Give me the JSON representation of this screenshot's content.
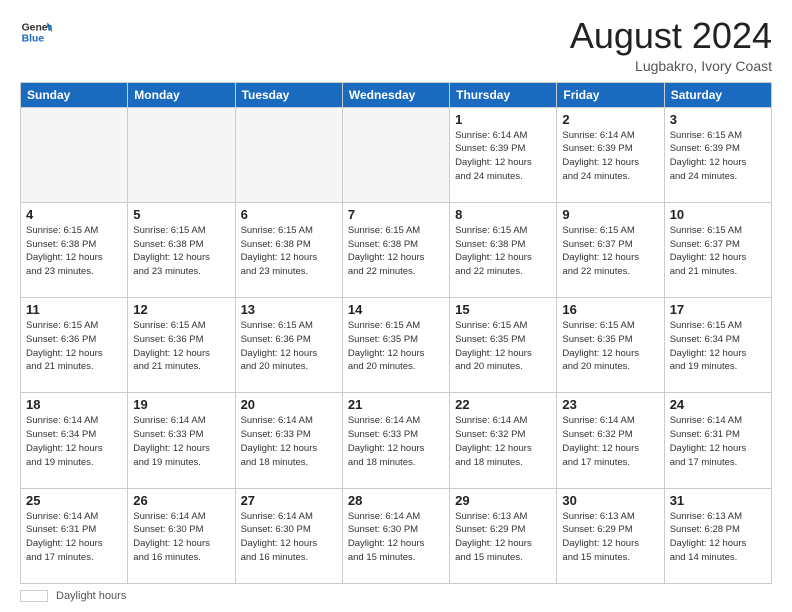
{
  "header": {
    "logo_general": "General",
    "logo_blue": "Blue",
    "title": "August 2024",
    "subtitle": "Lugbakro, Ivory Coast"
  },
  "days_of_week": [
    "Sunday",
    "Monday",
    "Tuesday",
    "Wednesday",
    "Thursday",
    "Friday",
    "Saturday"
  ],
  "weeks": [
    [
      {
        "day": "",
        "detail": ""
      },
      {
        "day": "",
        "detail": ""
      },
      {
        "day": "",
        "detail": ""
      },
      {
        "day": "",
        "detail": ""
      },
      {
        "day": "1",
        "detail": "Sunrise: 6:14 AM\nSunset: 6:39 PM\nDaylight: 12 hours\nand 24 minutes."
      },
      {
        "day": "2",
        "detail": "Sunrise: 6:14 AM\nSunset: 6:39 PM\nDaylight: 12 hours\nand 24 minutes."
      },
      {
        "day": "3",
        "detail": "Sunrise: 6:15 AM\nSunset: 6:39 PM\nDaylight: 12 hours\nand 24 minutes."
      }
    ],
    [
      {
        "day": "4",
        "detail": "Sunrise: 6:15 AM\nSunset: 6:38 PM\nDaylight: 12 hours\nand 23 minutes."
      },
      {
        "day": "5",
        "detail": "Sunrise: 6:15 AM\nSunset: 6:38 PM\nDaylight: 12 hours\nand 23 minutes."
      },
      {
        "day": "6",
        "detail": "Sunrise: 6:15 AM\nSunset: 6:38 PM\nDaylight: 12 hours\nand 23 minutes."
      },
      {
        "day": "7",
        "detail": "Sunrise: 6:15 AM\nSunset: 6:38 PM\nDaylight: 12 hours\nand 22 minutes."
      },
      {
        "day": "8",
        "detail": "Sunrise: 6:15 AM\nSunset: 6:38 PM\nDaylight: 12 hours\nand 22 minutes."
      },
      {
        "day": "9",
        "detail": "Sunrise: 6:15 AM\nSunset: 6:37 PM\nDaylight: 12 hours\nand 22 minutes."
      },
      {
        "day": "10",
        "detail": "Sunrise: 6:15 AM\nSunset: 6:37 PM\nDaylight: 12 hours\nand 21 minutes."
      }
    ],
    [
      {
        "day": "11",
        "detail": "Sunrise: 6:15 AM\nSunset: 6:36 PM\nDaylight: 12 hours\nand 21 minutes."
      },
      {
        "day": "12",
        "detail": "Sunrise: 6:15 AM\nSunset: 6:36 PM\nDaylight: 12 hours\nand 21 minutes."
      },
      {
        "day": "13",
        "detail": "Sunrise: 6:15 AM\nSunset: 6:36 PM\nDaylight: 12 hours\nand 20 minutes."
      },
      {
        "day": "14",
        "detail": "Sunrise: 6:15 AM\nSunset: 6:35 PM\nDaylight: 12 hours\nand 20 minutes."
      },
      {
        "day": "15",
        "detail": "Sunrise: 6:15 AM\nSunset: 6:35 PM\nDaylight: 12 hours\nand 20 minutes."
      },
      {
        "day": "16",
        "detail": "Sunrise: 6:15 AM\nSunset: 6:35 PM\nDaylight: 12 hours\nand 20 minutes."
      },
      {
        "day": "17",
        "detail": "Sunrise: 6:15 AM\nSunset: 6:34 PM\nDaylight: 12 hours\nand 19 minutes."
      }
    ],
    [
      {
        "day": "18",
        "detail": "Sunrise: 6:14 AM\nSunset: 6:34 PM\nDaylight: 12 hours\nand 19 minutes."
      },
      {
        "day": "19",
        "detail": "Sunrise: 6:14 AM\nSunset: 6:33 PM\nDaylight: 12 hours\nand 19 minutes."
      },
      {
        "day": "20",
        "detail": "Sunrise: 6:14 AM\nSunset: 6:33 PM\nDaylight: 12 hours\nand 18 minutes."
      },
      {
        "day": "21",
        "detail": "Sunrise: 6:14 AM\nSunset: 6:33 PM\nDaylight: 12 hours\nand 18 minutes."
      },
      {
        "day": "22",
        "detail": "Sunrise: 6:14 AM\nSunset: 6:32 PM\nDaylight: 12 hours\nand 18 minutes."
      },
      {
        "day": "23",
        "detail": "Sunrise: 6:14 AM\nSunset: 6:32 PM\nDaylight: 12 hours\nand 17 minutes."
      },
      {
        "day": "24",
        "detail": "Sunrise: 6:14 AM\nSunset: 6:31 PM\nDaylight: 12 hours\nand 17 minutes."
      }
    ],
    [
      {
        "day": "25",
        "detail": "Sunrise: 6:14 AM\nSunset: 6:31 PM\nDaylight: 12 hours\nand 17 minutes."
      },
      {
        "day": "26",
        "detail": "Sunrise: 6:14 AM\nSunset: 6:30 PM\nDaylight: 12 hours\nand 16 minutes."
      },
      {
        "day": "27",
        "detail": "Sunrise: 6:14 AM\nSunset: 6:30 PM\nDaylight: 12 hours\nand 16 minutes."
      },
      {
        "day": "28",
        "detail": "Sunrise: 6:14 AM\nSunset: 6:30 PM\nDaylight: 12 hours\nand 15 minutes."
      },
      {
        "day": "29",
        "detail": "Sunrise: 6:13 AM\nSunset: 6:29 PM\nDaylight: 12 hours\nand 15 minutes."
      },
      {
        "day": "30",
        "detail": "Sunrise: 6:13 AM\nSunset: 6:29 PM\nDaylight: 12 hours\nand 15 minutes."
      },
      {
        "day": "31",
        "detail": "Sunrise: 6:13 AM\nSunset: 6:28 PM\nDaylight: 12 hours\nand 14 minutes."
      }
    ]
  ],
  "footer": {
    "legend_label": "Daylight hours"
  }
}
